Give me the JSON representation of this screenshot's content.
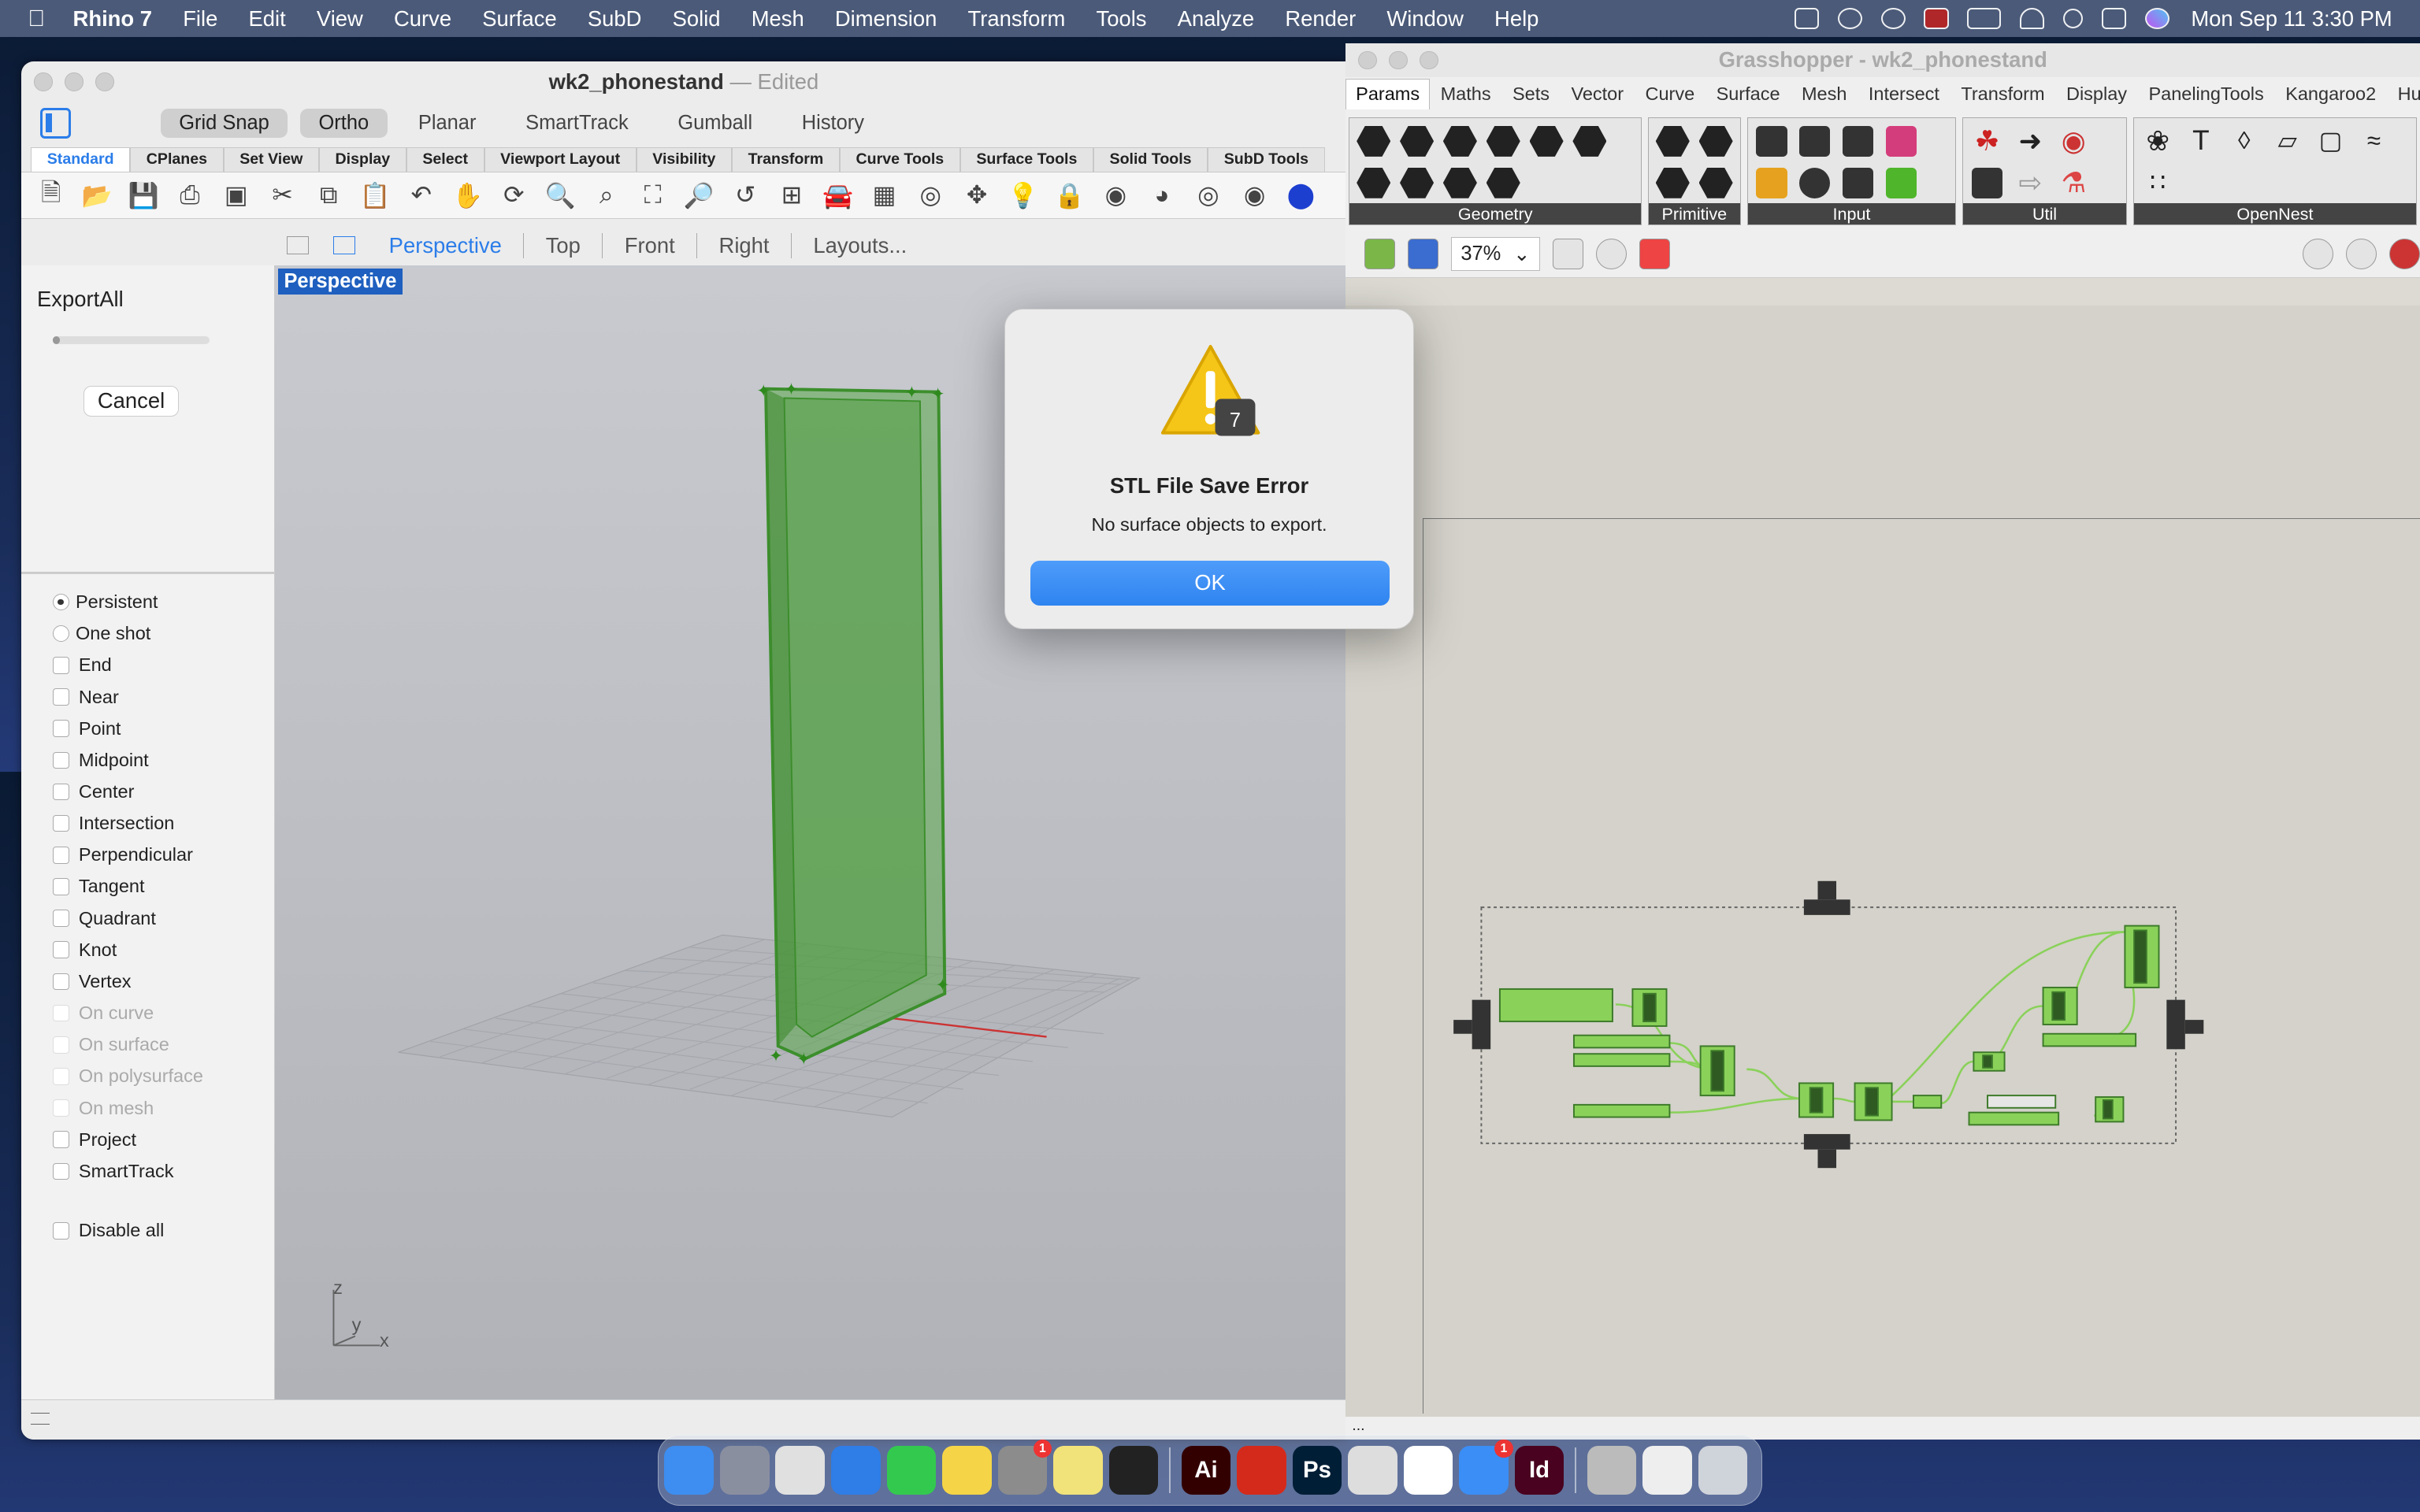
{
  "menubar": {
    "app_name": "Rhino 7",
    "items": [
      "File",
      "Edit",
      "View",
      "Curve",
      "Surface",
      "SubD",
      "Solid",
      "Mesh",
      "Dimension",
      "Transform",
      "Tools",
      "Analyze",
      "Render",
      "Window",
      "Help"
    ],
    "clock": "Mon Sep 11  3:30 PM"
  },
  "rhino": {
    "title": "wk2_phonestand",
    "title_suffix": "— Edited",
    "osnap_pills": [
      {
        "label": "Grid Snap",
        "on": true
      },
      {
        "label": "Ortho",
        "on": true
      },
      {
        "label": "Planar",
        "on": false
      },
      {
        "label": "SmartTrack",
        "on": false
      },
      {
        "label": "Gumball",
        "on": false
      },
      {
        "label": "History",
        "on": false
      }
    ],
    "tool_tabs": [
      "Standard",
      "CPlanes",
      "Set View",
      "Display",
      "Select",
      "Viewport Layout",
      "Visibility",
      "Transform",
      "Curve Tools",
      "Surface Tools",
      "Solid Tools",
      "SubD Tools"
    ],
    "viewport_tabs": [
      "Perspective",
      "Top",
      "Front",
      "Right",
      "Layouts..."
    ],
    "viewport_label": "Perspective",
    "command": {
      "name": "ExportAll",
      "cancel_label": "Cancel"
    },
    "snap_mode": [
      {
        "label": "Persistent",
        "selected": true
      },
      {
        "label": "One shot",
        "selected": false
      }
    ],
    "snaps": [
      {
        "label": "End",
        "enabled": true
      },
      {
        "label": "Near",
        "enabled": true
      },
      {
        "label": "Point",
        "enabled": true
      },
      {
        "label": "Midpoint",
        "enabled": true
      },
      {
        "label": "Center",
        "enabled": true
      },
      {
        "label": "Intersection",
        "enabled": true
      },
      {
        "label": "Perpendicular",
        "enabled": true
      },
      {
        "label": "Tangent",
        "enabled": true
      },
      {
        "label": "Quadrant",
        "enabled": true
      },
      {
        "label": "Knot",
        "enabled": true
      },
      {
        "label": "Vertex",
        "enabled": true
      },
      {
        "label": "On curve",
        "enabled": false
      },
      {
        "label": "On surface",
        "enabled": false
      },
      {
        "label": "On polysurface",
        "enabled": false
      },
      {
        "label": "On mesh",
        "enabled": false
      },
      {
        "label": "Project",
        "enabled": true
      },
      {
        "label": "SmartTrack",
        "enabled": true
      }
    ],
    "disable_all": "Disable all",
    "axes": {
      "z": "z",
      "y": "y",
      "x": "x"
    }
  },
  "grasshopper": {
    "title": "Grasshopper - wk2_phonestand",
    "tabs": [
      "Params",
      "Maths",
      "Sets",
      "Vector",
      "Curve",
      "Surface",
      "Mesh",
      "Intersect",
      "Transform",
      "Display",
      "PanelingTools",
      "Kangaroo2",
      "Human"
    ],
    "groups": [
      "Geometry",
      "Primitive",
      "Input",
      "Util",
      "OpenNest"
    ],
    "zoom": "37%",
    "status": "..."
  },
  "dialog": {
    "title": "STL File Save Error",
    "message": "No surface objects to export.",
    "ok_label": "OK"
  },
  "dock": {
    "apps": [
      {
        "name": "finder",
        "color": "#3d8ef0",
        "text": ""
      },
      {
        "name": "launchpad",
        "color": "#8a8fa0",
        "text": ""
      },
      {
        "name": "chrome",
        "color": "#e0e0e0",
        "text": ""
      },
      {
        "name": "keynote",
        "color": "#2f7de6",
        "text": ""
      },
      {
        "name": "messages",
        "color": "#33c94f",
        "text": ""
      },
      {
        "name": "notes",
        "color": "#f5d547",
        "text": ""
      },
      {
        "name": "system-settings",
        "color": "#8c8c8c",
        "text": ""
      },
      {
        "name": "stickies",
        "color": "#f2e27a",
        "text": ""
      },
      {
        "name": "figma",
        "color": "#222",
        "text": ""
      },
      {
        "name": "illustrator",
        "color": "#330000",
        "text": "Ai"
      },
      {
        "name": "acrobat",
        "color": "#d42a1c",
        "text": ""
      },
      {
        "name": "photoshop",
        "color": "#001e36",
        "text": "Ps"
      },
      {
        "name": "rhino",
        "color": "#ddd",
        "text": ""
      },
      {
        "name": "slack",
        "color": "#fff",
        "text": ""
      },
      {
        "name": "mail",
        "color": "#3b8ef5",
        "text": ""
      },
      {
        "name": "indesign",
        "color": "#49021f",
        "text": "Id"
      },
      {
        "name": "screenshot-1",
        "color": "#bbb",
        "text": ""
      },
      {
        "name": "screenshot-2",
        "color": "#eee",
        "text": ""
      },
      {
        "name": "trash",
        "color": "#cfd3da",
        "text": ""
      }
    ],
    "badges": {
      "system-settings": "1",
      "mail": "1"
    }
  }
}
